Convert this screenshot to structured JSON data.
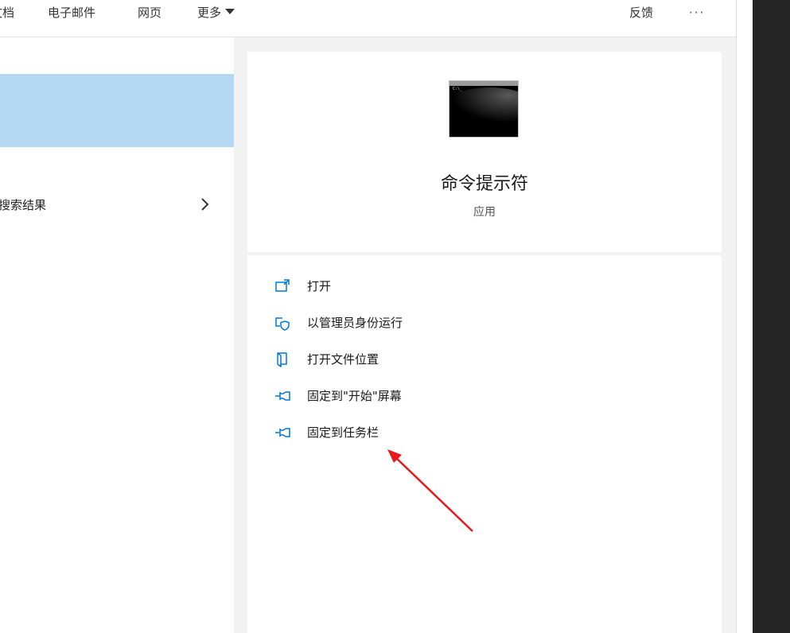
{
  "topbar": {
    "tabs": [
      "文档",
      "电子邮件",
      "网页",
      "更多"
    ],
    "feedback": "反馈",
    "more_options": "···"
  },
  "left": {
    "web_results_label": "搜索结果"
  },
  "app": {
    "name": "命令提示符",
    "type": "应用"
  },
  "actions": [
    {
      "label": "打开",
      "icon": "open-icon"
    },
    {
      "label": "以管理员身份运行",
      "icon": "shield-run-as-admin-icon"
    },
    {
      "label": "打开文件位置",
      "icon": "file-location-icon"
    },
    {
      "label": "固定到\"开始\"屏幕",
      "icon": "pin-icon"
    },
    {
      "label": "固定到任务栏",
      "icon": "pin-icon"
    }
  ],
  "colors": {
    "accent": "#0078d7",
    "selected": "#b4d7f2",
    "annotation_arrow": "#e8191d"
  }
}
